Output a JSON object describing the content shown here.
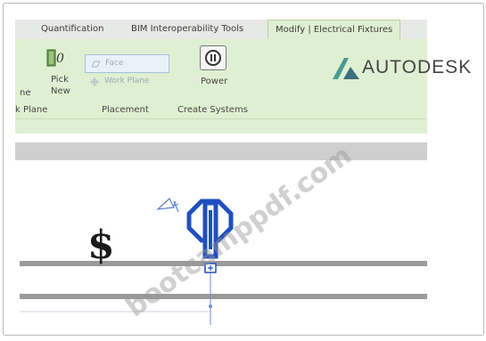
{
  "tabs": [
    {
      "label": "Quantification",
      "active": false
    },
    {
      "label": "BIM Interoperability Tools",
      "active": false
    },
    {
      "label": "Modify | Electrical Fixtures",
      "active": true
    }
  ],
  "ribbon": {
    "left_partial_label": "ne",
    "pick_new_label_1": "Pick",
    "pick_new_label_2": "New",
    "face_label": "Face",
    "work_plane_label": "Work Plane",
    "power_label": "Power",
    "panels": {
      "work_plane": "k Plane",
      "placement": "Placement",
      "create_systems": "Create Systems"
    }
  },
  "logo": {
    "text": "AUTODESK"
  },
  "canvas": {
    "symbol_text": "$",
    "watermark": "bootcamppdf.com"
  },
  "colors": {
    "ribbon_bg": "#dff0d2",
    "fixture_blue": "#1f4fbf",
    "wall_gray": "#9a9a9a"
  }
}
